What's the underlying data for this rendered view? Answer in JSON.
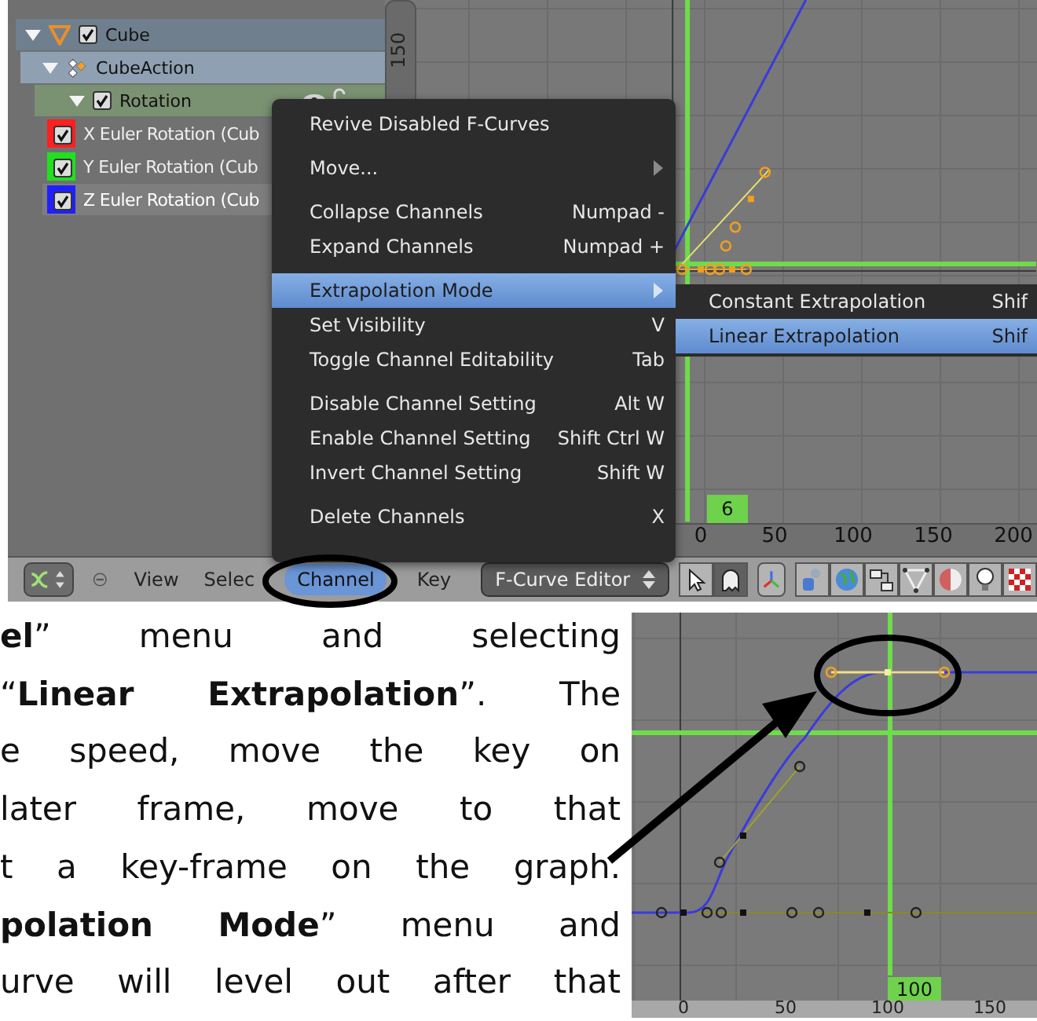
{
  "top_screenshot": {
    "channels": [
      {
        "label": "Cube",
        "kind": "object",
        "checked": true,
        "expanded": true,
        "children": [
          {
            "label": "CubeAction",
            "kind": "action",
            "expanded": true,
            "children": [
              {
                "label": "Rotation",
                "kind": "group",
                "checked": true,
                "expanded": true,
                "children": [
                  {
                    "label": "X Euler Rotation (Cub",
                    "kind": "fcurve",
                    "checked": true,
                    "selected": false,
                    "color": "#ff2020"
                  },
                  {
                    "label": "Y Euler Rotation (Cub",
                    "kind": "fcurve",
                    "checked": true,
                    "selected": false,
                    "color": "#20e020"
                  },
                  {
                    "label": "Z Euler Rotation (Cub",
                    "kind": "fcurve",
                    "checked": true,
                    "selected": true,
                    "color": "#2020ff"
                  }
                ]
              }
            ]
          }
        ]
      }
    ],
    "ruler_label": "150",
    "menu": {
      "groups": [
        [
          {
            "label": "Revive Disabled F-Curves",
            "submenu": false,
            "selected": false
          }
        ],
        [
          {
            "label": "Move...",
            "submenu": true,
            "selected": false
          }
        ],
        [
          {
            "label": "Collapse Channels",
            "shortcut": "Numpad -",
            "submenu": false,
            "selected": false
          },
          {
            "label": "Expand Channels",
            "shortcut": "Numpad +",
            "submenu": false,
            "selected": false
          }
        ],
        [
          {
            "label": "Extrapolation Mode",
            "submenu": true,
            "selected": true
          },
          {
            "label": "Set Visibility",
            "shortcut": "V",
            "submenu": false,
            "selected": false
          },
          {
            "label": "Toggle Channel Editability",
            "shortcut": "Tab",
            "submenu": false,
            "selected": false
          }
        ],
        [
          {
            "label": "Disable Channel Setting",
            "shortcut": "Alt W",
            "submenu": false,
            "selected": false
          },
          {
            "label": "Enable Channel Setting",
            "shortcut": "Shift Ctrl W",
            "submenu": false,
            "selected": false
          },
          {
            "label": "Invert Channel Setting",
            "shortcut": "Shift W",
            "submenu": false,
            "selected": false
          }
        ],
        [
          {
            "label": "Delete Channels",
            "shortcut": "X",
            "submenu": false,
            "selected": false
          }
        ]
      ]
    },
    "submenu": [
      {
        "label": "Constant Extrapolation",
        "shortcut": "Shif",
        "selected": false
      },
      {
        "label": "Linear Extrapolation",
        "shortcut": "Shif",
        "selected": true
      }
    ],
    "x_axis_labels": [
      "0",
      "50",
      "100",
      "150",
      "200"
    ],
    "current_frame": "6",
    "header": {
      "menus": [
        {
          "label": "View",
          "selected": false
        },
        {
          "label": "Selec",
          "selected": false
        },
        {
          "label": "Channel",
          "selected": true
        },
        {
          "label": "Key",
          "selected": false
        }
      ],
      "mode": "F-Curve Editor"
    }
  },
  "text_lines": [
    "**el**” menu and selecting",
    "“**Linear Extrapolation**”. The",
    "e speed, move the key on",
    "later frame, move to that",
    "t a key-frame on the graph.",
    "**polation Mode**” menu and",
    "urve will level out after that"
  ],
  "bottom_screenshot": {
    "current_frame": "100",
    "x_axis_labels": [
      "0",
      "50",
      "100",
      "150"
    ]
  }
}
